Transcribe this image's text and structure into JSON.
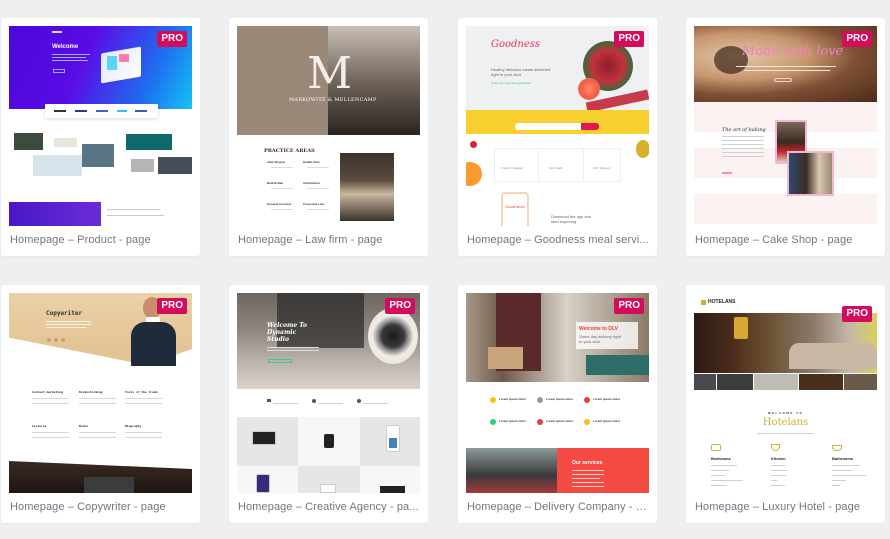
{
  "badge_label": "PRO",
  "colors": {
    "background": "#eeeff1",
    "card": "#ffffff",
    "label_text": "#6d7882",
    "pro_badge": "#d30c5c"
  },
  "templates": [
    {
      "label": "Homepage – Product - page",
      "pro": true,
      "thumb": {
        "hero_heading": "Welcome"
      }
    },
    {
      "label": "Homepage – Law firm - page",
      "pro": false,
      "thumb": {
        "monogram": "M",
        "firm_name": "Markowitz & Mellencamp",
        "section_title": "Practice Areas",
        "areas": [
          "Joint Degree",
          "Health Care",
          "Real Estate",
          "Arbitrations",
          "General Counsel",
          "Corporate Law"
        ]
      }
    },
    {
      "label": "Homepage – Goodness meal servi...",
      "pro": true,
      "thumb": {
        "brand": "Goodness",
        "headline": "Healthy delicious meals delivered right to your door",
        "subline": "Color your day with goodness.",
        "features": [
          "Fresh & Organic",
          "Top Chefs",
          "24/7 Delivery"
        ],
        "app_cta": "Download the app and start exploring"
      }
    },
    {
      "label": "Homepage – Cake Shop - page",
      "pro": true,
      "thumb": {
        "hero_heading": "Made with love",
        "section_title": "The art of baking"
      }
    },
    {
      "label": "Homepage – Copywriter - page",
      "pro": true,
      "thumb": {
        "hero_heading": "Copywriter",
        "services": [
          "Content marketing",
          "Brainstorming",
          "Tools of the trade",
          "Lectures",
          "Books",
          "Biography"
        ]
      }
    },
    {
      "label": "Homepage – Creative Agency - pa...",
      "pro": true,
      "thumb": {
        "hero_heading": "Welcome To Dynamic Studio"
      }
    },
    {
      "label": "Homepage – Delivery Company - p...",
      "pro": true,
      "thumb": {
        "hero_heading": "Welcome to DLV",
        "hero_sub": "Same day delivery right to your door",
        "feature_title": "Lorem Ipsum dolor",
        "services_title": "Our services"
      }
    },
    {
      "label": "Homepage – Luxury Hotel - page",
      "pro": true,
      "thumb": {
        "brand": "HOTELANS",
        "welcome": "WELCOME TO",
        "title": "Hotelans",
        "columns": [
          "Bedrooms",
          "Kitchen",
          "Bathrooms"
        ]
      }
    }
  ]
}
